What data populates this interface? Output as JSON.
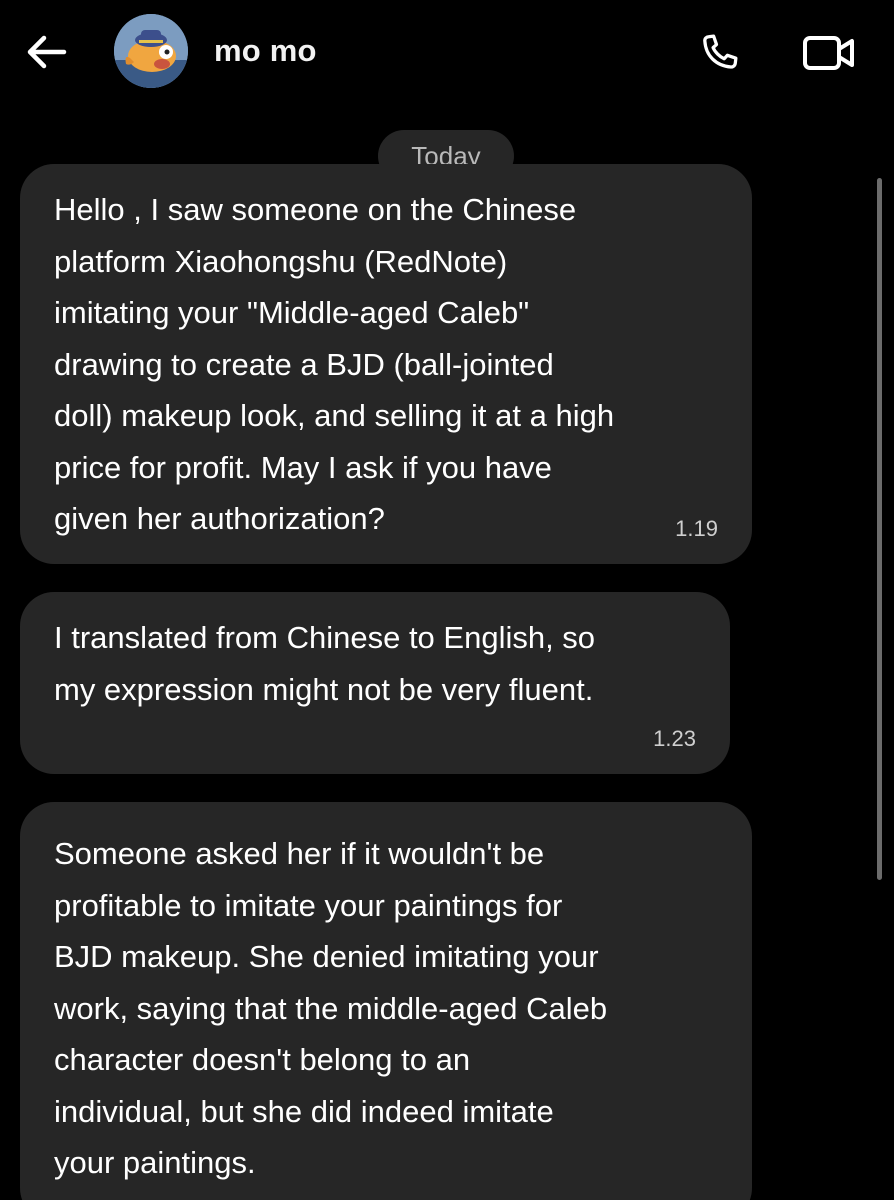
{
  "header": {
    "contact_name": "mo mo",
    "icons": {
      "back": "arrow-left-icon",
      "avatar": "cartoon-fish-avatar",
      "call": "phone-icon",
      "video": "video-camera-icon"
    }
  },
  "date_divider": "Today",
  "messages": [
    {
      "text": "Hello , I saw someone on the Chinese\nplatform Xiaohongshu (RedNote)\nimitating your \"Middle-aged Caleb\"\ndrawing to create a BJD (ball-jointed\ndoll) makeup look, and selling it at a high\nprice for profit. May I ask if you have\ngiven her authorization?",
      "time": "1.19"
    },
    {
      "text": "I translated from Chinese to English, so\nmy expression might not be very fluent.",
      "time": "1.23"
    },
    {
      "text": "Someone asked her if it wouldn't be\nprofitable to imitate your paintings for\nBJD makeup. She denied imitating your\nwork, saying that the middle-aged Caleb\ncharacter doesn't belong to an\nindividual, but she did indeed imitate\nyour paintings.",
      "time": ""
    }
  ],
  "colors": {
    "background": "#000000",
    "bubble": "#262626",
    "text": "#ffffff",
    "muted_text": "#b9b9b9"
  }
}
